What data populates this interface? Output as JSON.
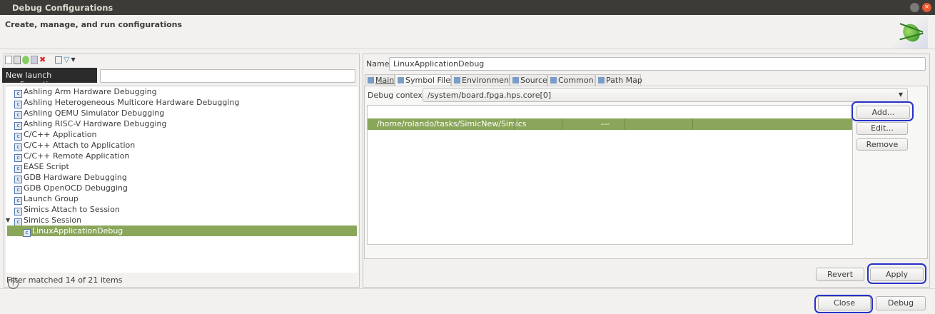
{
  "window": {
    "title": "Debug Configurations",
    "subtitle": "Create, manage, and run configurations"
  },
  "toolbar": {
    "icons": [
      "new-config-icon",
      "new-prototype-icon",
      "duplicate-icon",
      "export-icon",
      "delete-icon",
      "collapse-all-icon",
      "filter-icon",
      "dropdown-icon"
    ],
    "tooltip": "New launch configuration"
  },
  "tree": {
    "items": [
      {
        "label": "Ashling Arm Hardware Debugging",
        "icon": "c-config-icon"
      },
      {
        "label": "Ashling Heterogeneous Multicore Hardware Debugging",
        "icon": "multicore-icon"
      },
      {
        "label": "Ashling QEMU Simulator Debugging",
        "icon": "c-config-icon"
      },
      {
        "label": "Ashling RISC-V Hardware Debugging",
        "icon": "c-config-icon"
      },
      {
        "label": "C/C++ Application",
        "icon": "c-config-icon"
      },
      {
        "label": "C/C++ Attach to Application",
        "icon": "c-config-icon"
      },
      {
        "label": "C/C++ Remote Application",
        "icon": "c-config-icon"
      },
      {
        "label": "EASE Script",
        "icon": "script-icon"
      },
      {
        "label": "GDB Hardware Debugging",
        "icon": "c-config-icon"
      },
      {
        "label": "GDB OpenOCD Debugging",
        "icon": "c-config-icon"
      },
      {
        "label": "Launch Group",
        "icon": "launch-group-icon"
      },
      {
        "label": "Simics Attach to Session",
        "icon": "simics-icon"
      },
      {
        "label": "Simics Session",
        "icon": "simics-icon",
        "expanded": true
      },
      {
        "label": "LinuxApplicationDebug",
        "icon": "simics-icon",
        "selected": true,
        "child": true
      }
    ],
    "status": "Filter matched 14 of 21 items"
  },
  "config": {
    "name_label": "Name:",
    "name_value": "LinuxApplicationDebug",
    "tabs": [
      {
        "label": "Main",
        "icon": "simics-icon"
      },
      {
        "label": "Symbol Files",
        "icon": "symbol-files-icon",
        "active": true
      },
      {
        "label": "Environment",
        "icon": "environment-icon"
      },
      {
        "label": "Source",
        "icon": "source-icon"
      },
      {
        "label": "Common",
        "icon": "common-icon"
      },
      {
        "label": "Path Map",
        "icon": "path-map-icon"
      }
    ],
    "debug_context_label": "Debug context:",
    "debug_context_value": "/system/board.fpga.hps.core[0]",
    "symbol_rows": [
      {
        "path": "/home/rolando/tasks/SimicNew/Simics",
        "col3": "---",
        "selected": true
      }
    ],
    "buttons": {
      "add": "Add...",
      "edit": "Edit...",
      "remove": "Remove",
      "revert": "Revert",
      "apply": "Apply"
    }
  },
  "footer": {
    "close": "Close",
    "debug": "Debug",
    "help": "?"
  },
  "colors": {
    "selection": "#8aa65a",
    "highlight_ring": "#2830c8",
    "titlebar": "#3c3b37"
  }
}
